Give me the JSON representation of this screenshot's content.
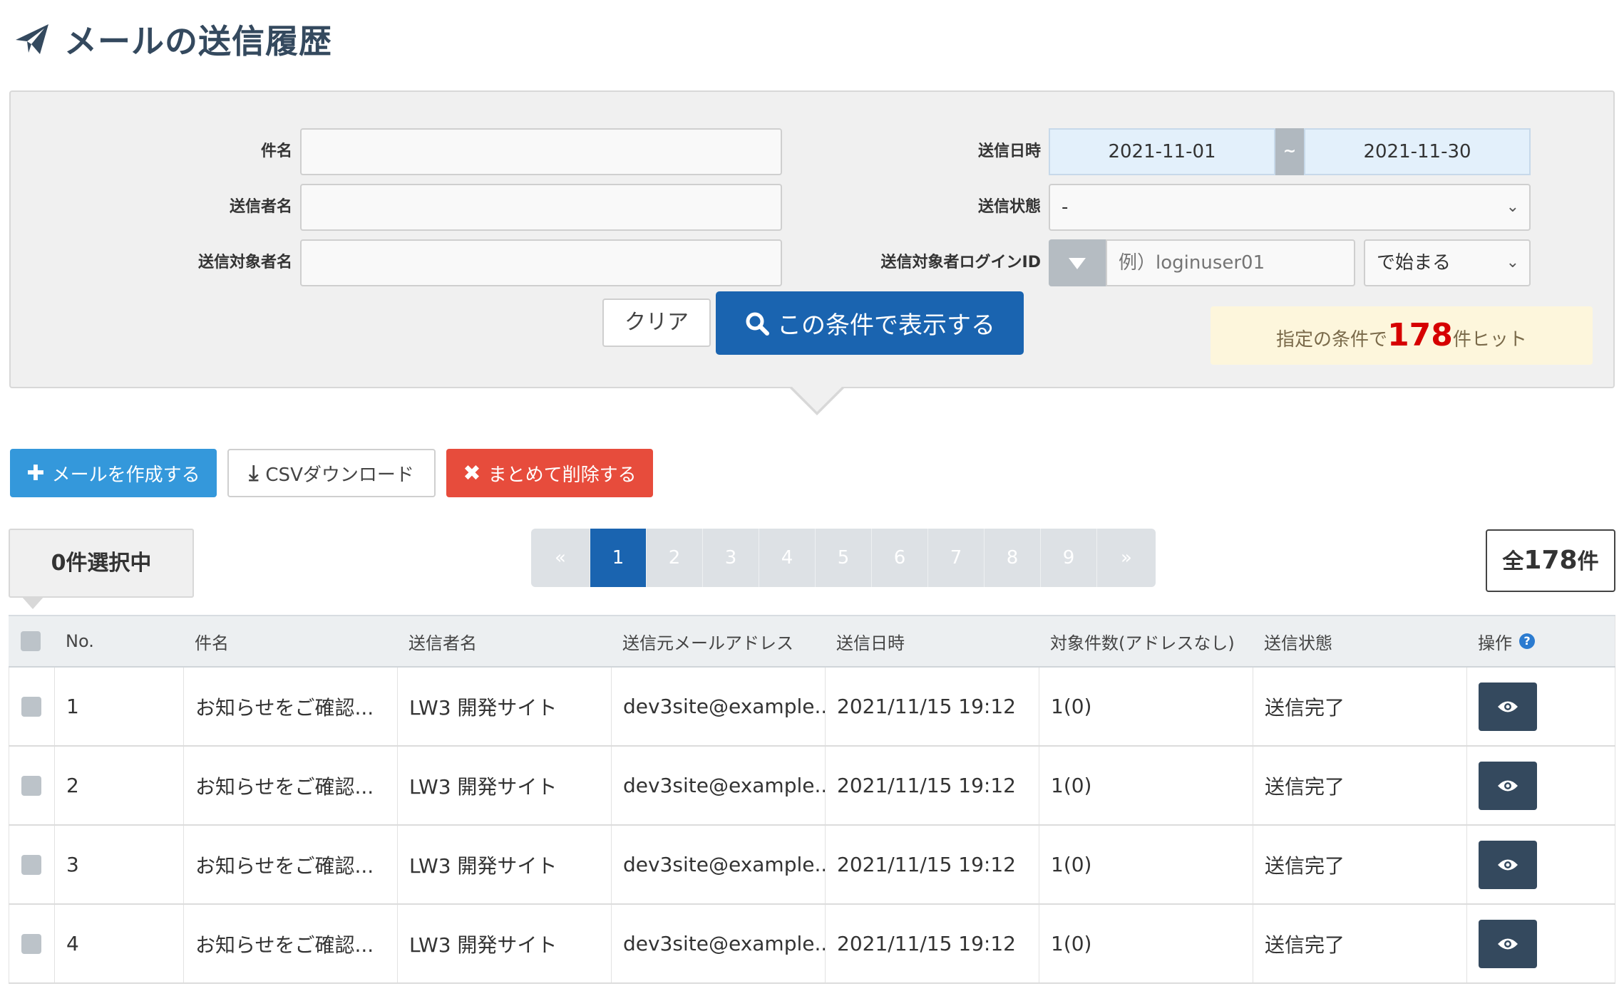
{
  "header": {
    "title": "メールの送信履歴",
    "icon": "paper-plane-icon"
  },
  "search": {
    "subject_label": "件名",
    "sender_label": "送信者名",
    "target_label": "送信対象者名",
    "datetime_label": "送信日時",
    "date_from": "2021-11-01",
    "date_sep": "~",
    "date_to": "2021-11-30",
    "status_label": "送信状態",
    "status_value": "-",
    "login_label": "送信対象者ログインID",
    "login_placeholder": "例）loginuser01",
    "match_value": "で始まる",
    "clear_label": "クリア",
    "submit_label": "この条件で表示する",
    "hit_prefix": "指定の条件で",
    "hit_count": "178",
    "hit_suffix": "件ヒット"
  },
  "actions": {
    "create_label": "メールを作成する",
    "csv_label": "CSVダウンロード",
    "delete_label": "まとめて削除する"
  },
  "selection": {
    "count": "0",
    "suffix": "件選択中"
  },
  "pagination": {
    "prev": "«",
    "pages": [
      "1",
      "2",
      "3",
      "4",
      "5",
      "6",
      "7",
      "8",
      "9"
    ],
    "next": "»",
    "current": "1"
  },
  "total": {
    "prefix": "全",
    "count": "178",
    "suffix": "件"
  },
  "table": {
    "columns": [
      "No.",
      "件名",
      "送信者名",
      "送信元メールアドレス",
      "送信日時",
      "対象件数(アドレスなし)",
      "送信状態",
      "操作"
    ],
    "rows": [
      {
        "no": "1",
        "subject": "お知らせをご確認...",
        "sender": "LW3 開発サイト",
        "from": "dev3site@example....",
        "sent_at": "2021/11/15 19:12",
        "count": "1(0)",
        "status": "送信完了"
      },
      {
        "no": "2",
        "subject": "お知らせをご確認...",
        "sender": "LW3 開発サイト",
        "from": "dev3site@example....",
        "sent_at": "2021/11/15 19:12",
        "count": "1(0)",
        "status": "送信完了"
      },
      {
        "no": "3",
        "subject": "お知らせをご確認...",
        "sender": "LW3 開発サイト",
        "from": "dev3site@example....",
        "sent_at": "2021/11/15 19:12",
        "count": "1(0)",
        "status": "送信完了"
      },
      {
        "no": "4",
        "subject": "お知らせをご確認...",
        "sender": "LW3 開発サイト",
        "from": "dev3site@example....",
        "sent_at": "2021/11/15 19:12",
        "count": "1(0)",
        "status": "送信完了"
      }
    ]
  },
  "colors": {
    "primary": "#1a64b0",
    "create": "#3498db",
    "danger": "#e74c3c",
    "dark": "#34495e",
    "hit": "#d60000"
  }
}
